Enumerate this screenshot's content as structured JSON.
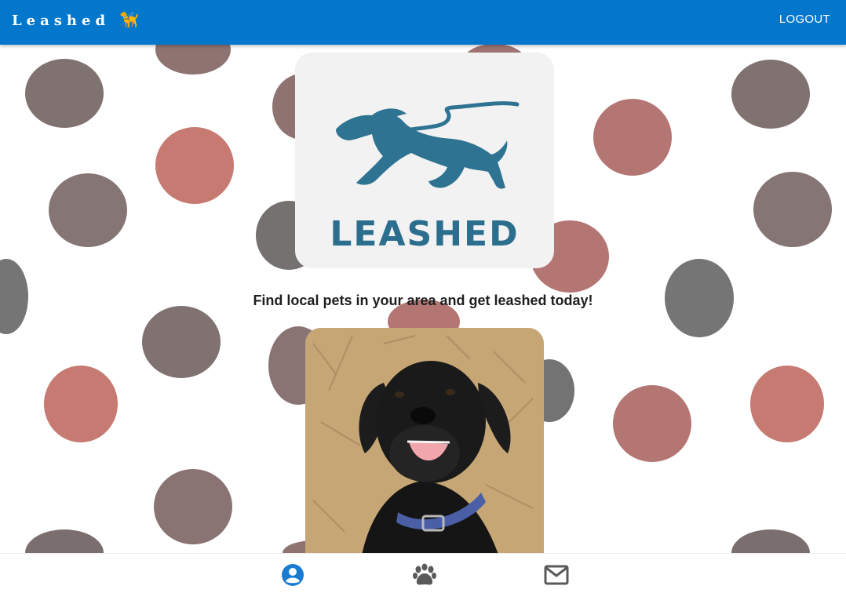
{
  "appbar": {
    "brand": "Leashed",
    "brand_icon": "dog-on-leash-icon",
    "logout_label": "LOGOUT"
  },
  "logo": {
    "wordmark": "LEASHED",
    "icon": "leashed-dog-logo"
  },
  "main": {
    "tagline": "Find local pets in your area and get leashed today!"
  },
  "bottom_nav": {
    "items": [
      {
        "icon": "profile-icon",
        "active": true
      },
      {
        "icon": "paw-icon",
        "active": false
      },
      {
        "icon": "mail-icon",
        "active": false
      }
    ]
  },
  "colors": {
    "appbar": "#0277cc",
    "logo_blue": "#2b6e8e",
    "active_nav": "#1a7bcf",
    "inactive_nav": "#5a5a5a"
  }
}
